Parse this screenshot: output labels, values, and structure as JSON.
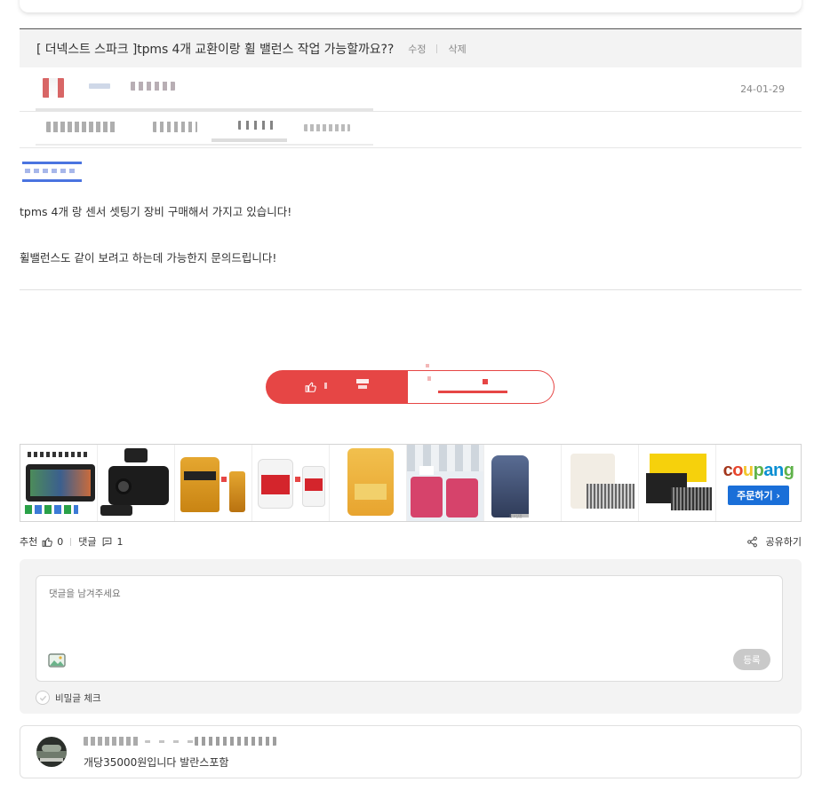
{
  "post": {
    "title": "[ 더넥스트 스파크 ]tpms 4개 교환이랑 휠 밸런스 작업 가능할까요??",
    "edit_label": "수정",
    "delete_label": "삭제",
    "date": "24-01-29",
    "body": [
      "tpms 4개 랑 센서 셋팅기 장비 구매해서 가지고 있습니다!",
      "휠밸런스도 같이 보려고 하는데 가능한지 문의드립니다!"
    ]
  },
  "ads": {
    "coupang_logo": "coupang",
    "coupang_button": "주문하기 ›",
    "small_caption": "광고상품"
  },
  "stats": {
    "recommend_label": "추천",
    "recommend_count": "0",
    "comment_label": "댓글",
    "comment_count": "1",
    "share_label": "공유하기"
  },
  "comment_form": {
    "placeholder": "댓글을 남겨주세요",
    "submit_label": "등록",
    "secret_label": "비밀글 체크"
  },
  "replies": [
    {
      "text": "개당35000원입니다 발란스포함"
    }
  ],
  "colors": {
    "accent_red": "#e64645",
    "coupang_blue": "#1a6fd8",
    "header_bg": "#f3f3f3"
  }
}
